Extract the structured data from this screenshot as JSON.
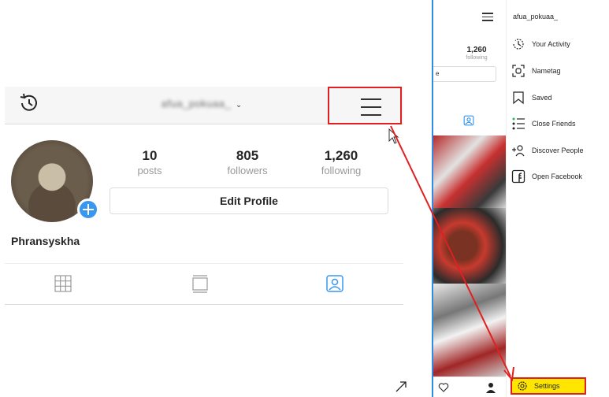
{
  "profile": {
    "username": "afua_pokuaa_",
    "display_name": "Phransyskha",
    "stats": [
      {
        "value": "10",
        "label": "posts"
      },
      {
        "value": "805",
        "label": "followers"
      },
      {
        "value": "1,260",
        "label": "following"
      }
    ],
    "edit_button": "Edit Profile"
  },
  "drawer_screenshot": {
    "username": "afua_pokuaa_",
    "following_count": "1,260",
    "following_label": "following",
    "edit_fragment": "e",
    "menu_items": [
      {
        "label": "Your Activity",
        "icon": "activity-icon"
      },
      {
        "label": "Nametag",
        "icon": "nametag-icon"
      },
      {
        "label": "Saved",
        "icon": "bookmark-icon"
      },
      {
        "label": "Close Friends",
        "icon": "close-friends-icon"
      },
      {
        "label": "Discover People",
        "icon": "add-person-icon"
      },
      {
        "label": "Open Facebook",
        "icon": "facebook-icon"
      }
    ],
    "settings_label": "Settings"
  },
  "colors": {
    "highlight_red": "#e02020",
    "highlight_yellow": "#ffe600",
    "accent_blue": "#3897f0"
  }
}
